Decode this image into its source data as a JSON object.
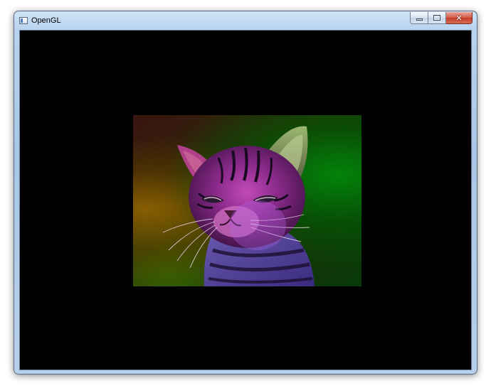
{
  "window": {
    "title": "OpenGL",
    "buttons": {
      "minimize_icon": "minimize-icon",
      "maximize_icon": "maximize-icon",
      "close_icon": "close-icon",
      "close_glyph": "✕"
    }
  },
  "viewport": {
    "background_color": "#000000",
    "image": {
      "subject": "kitten",
      "tint_colors": [
        "#b02aa0",
        "#2a9a10",
        "#a06a00",
        "#6a4ad0"
      ]
    }
  }
}
